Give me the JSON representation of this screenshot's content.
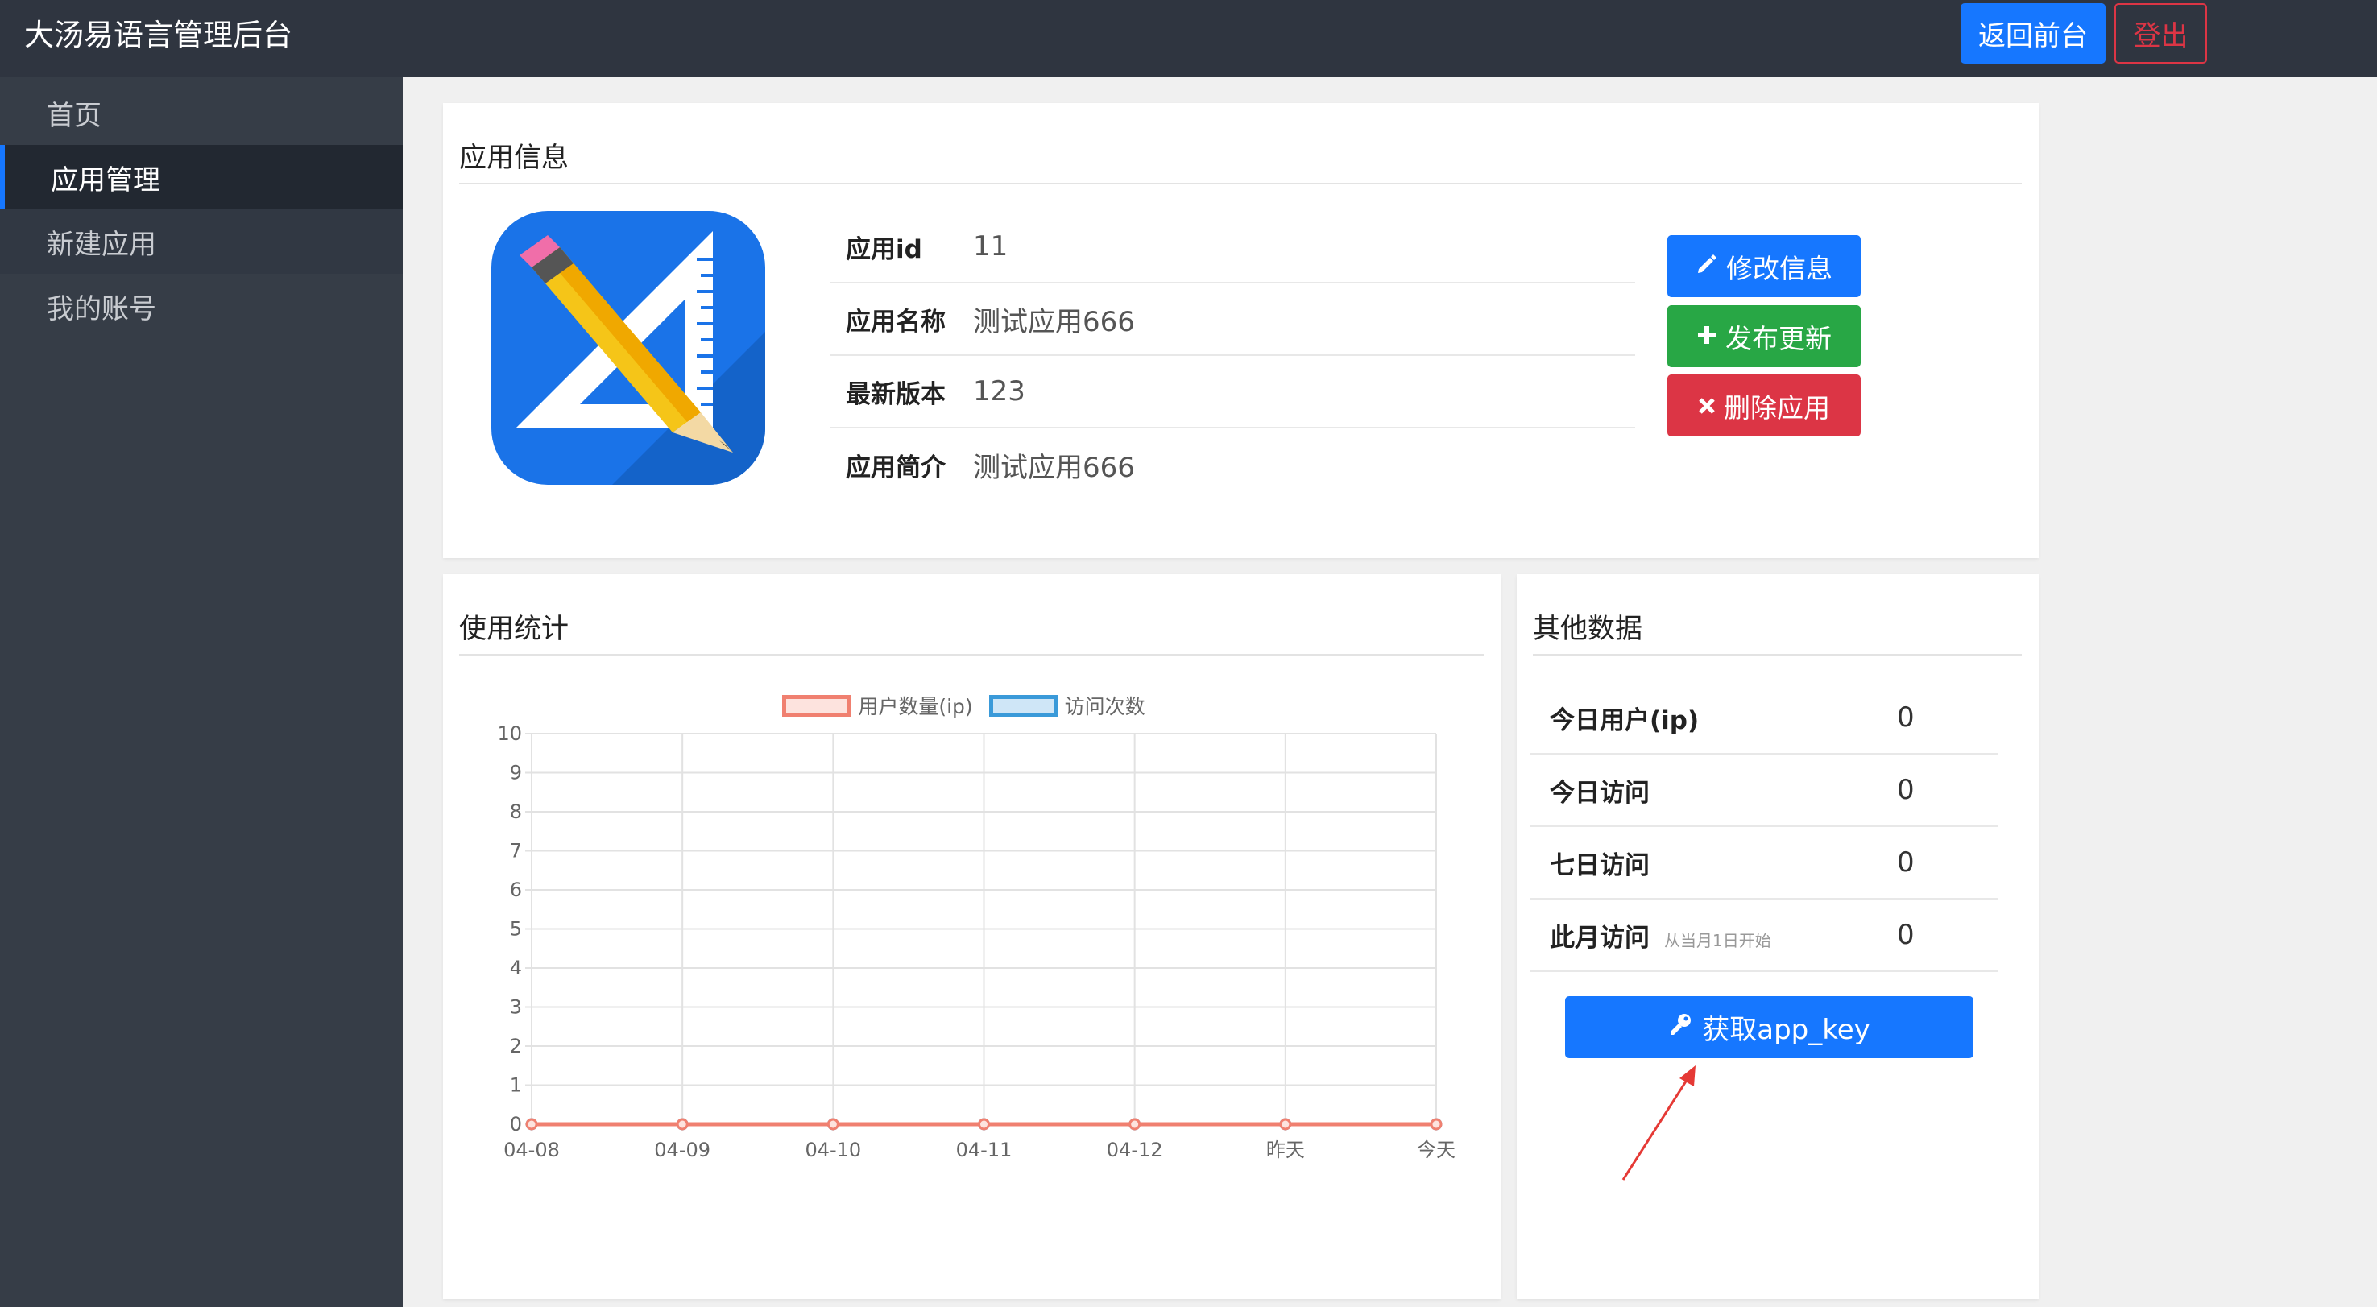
{
  "header": {
    "brand": "大汤易语言管理后台",
    "front_button": "返回前台",
    "logout_button": "登出"
  },
  "sidebar": {
    "items": [
      {
        "label": "首页"
      },
      {
        "label": "应用管理"
      },
      {
        "label": "新建应用"
      },
      {
        "label": "我的账号"
      }
    ],
    "active_index": 1
  },
  "app_info": {
    "title": "应用信息",
    "rows": [
      {
        "label": "应用id",
        "value": "11"
      },
      {
        "label": "应用名称",
        "value": "测试应用666"
      },
      {
        "label": "最新版本",
        "value": "123"
      },
      {
        "label": "应用简介",
        "value": "测试应用666"
      }
    ],
    "actions": {
      "edit": "修改信息",
      "publish": "发布更新",
      "delete": "删除应用"
    }
  },
  "usage": {
    "title": "使用统计"
  },
  "chart_data": {
    "type": "line",
    "categories": [
      "04-08",
      "04-09",
      "04-10",
      "04-11",
      "04-12",
      "昨天",
      "今天"
    ],
    "series": [
      {
        "name": "用户数量(ip)",
        "values": [
          0,
          0,
          0,
          0,
          0,
          0,
          0
        ],
        "color": "#f08070",
        "fill": "#fde3de"
      },
      {
        "name": "访问次数",
        "values": [
          0,
          0,
          0,
          0,
          0,
          0,
          0
        ],
        "color": "#3a9ad9",
        "fill": "#cfe6f7"
      }
    ],
    "ylim": [
      0,
      10
    ],
    "yticks": [
      "0",
      "1",
      "2",
      "3",
      "4",
      "5",
      "6",
      "7",
      "8",
      "9",
      "10"
    ],
    "grid": true,
    "legend": "top"
  },
  "other": {
    "title": "其他数据",
    "rows": [
      {
        "label": "今日用户(ip)",
        "note": "",
        "value": "0"
      },
      {
        "label": "今日访问",
        "note": "",
        "value": "0"
      },
      {
        "label": "七日访问",
        "note": "",
        "value": "0"
      },
      {
        "label": "此月访问",
        "note": "从当月1日开始",
        "value": "0"
      }
    ],
    "key_button": "获取app_key"
  },
  "colors": {
    "topbar": "#2f3540",
    "sidebar": "#363d47",
    "primary": "#1677ff",
    "success": "#28a745",
    "danger": "#dc3545"
  }
}
